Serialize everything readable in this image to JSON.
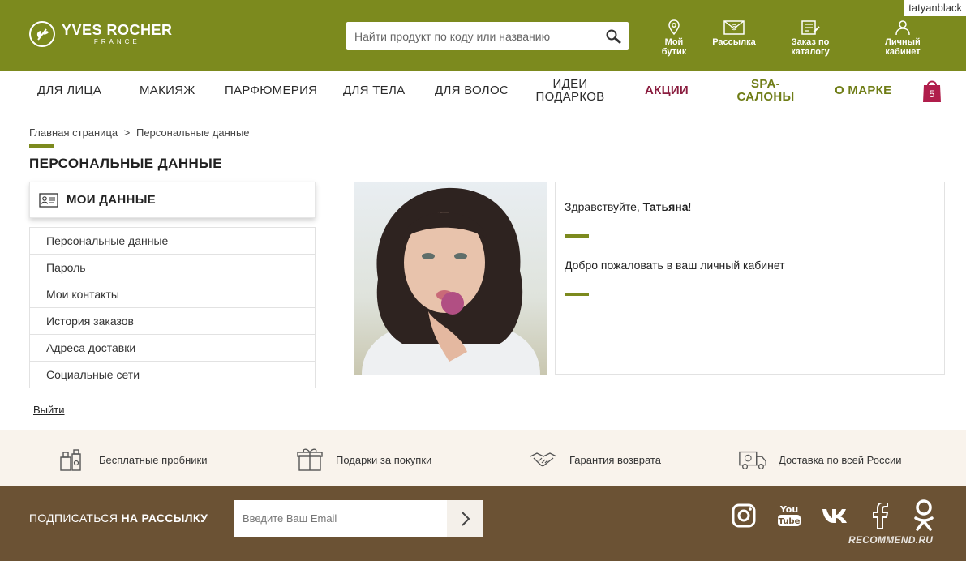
{
  "brand": {
    "name": "YVES ROCHER",
    "sub": "FRANCE",
    "color": "#7c8a1e"
  },
  "search": {
    "placeholder": "Найти продукт по коду или названию",
    "icon": "magnifier-icon"
  },
  "header_links": [
    {
      "label_line1": "Мой",
      "label_line2": "бутик",
      "icon": "location-pin-icon"
    },
    {
      "label_line1": "Рассылка",
      "label_line2": "",
      "icon": "newsletter-envelope-icon"
    },
    {
      "label_line1": "Заказ по",
      "label_line2": "каталогу",
      "icon": "catalog-order-icon"
    },
    {
      "label_line1": "Личный",
      "label_line2": "кабинет",
      "icon": "user-icon"
    }
  ],
  "username_badge": "tatyanblack",
  "nav": {
    "items": [
      {
        "label": "ДЛЯ ЛИЦА"
      },
      {
        "label": "МАКИЯЖ"
      },
      {
        "label": "ПАРФЮМЕРИЯ"
      },
      {
        "label": "ДЛЯ ТЕЛА"
      },
      {
        "label": "ДЛЯ ВОЛОС"
      },
      {
        "label_line1": "ИДЕИ",
        "label_line2": "ПОДАРКОВ"
      },
      {
        "label": "АКЦИИ"
      },
      {
        "label_line1": "SPA-",
        "label_line2": "САЛОНЫ"
      },
      {
        "label": "О МАРКЕ"
      }
    ],
    "cart_count": "5",
    "accent_color": "#8a1d3f"
  },
  "breadcrumb": {
    "home": "Главная страница",
    "separator": ">",
    "current": "Персональные данные"
  },
  "page_title": "ПЕРСОНАЛЬНЫЕ ДАННЫЕ",
  "sidebar": {
    "title": "МОИ ДАННЫЕ",
    "items": [
      {
        "label": "Персональные данные"
      },
      {
        "label": "Пароль"
      },
      {
        "label": "Мои контакты"
      },
      {
        "label": "История заказов"
      },
      {
        "label": "Адреса доставки"
      },
      {
        "label": "Социальные сети"
      }
    ],
    "logout": "Выйти"
  },
  "welcome": {
    "greeting": "Здравствуйте, ",
    "name": "Татьяна",
    "greeting_end": "!",
    "message": "Добро пожаловать в ваш личный кабинет"
  },
  "benefits": [
    {
      "label": "Бесплатные пробники",
      "icon": "samples-icon"
    },
    {
      "label": "Подарки за покупки",
      "icon": "gift-icon"
    },
    {
      "label": "Гарантия возврата",
      "icon": "handshake-icon"
    },
    {
      "label": "Доставка по всей России",
      "icon": "delivery-truck-icon"
    }
  ],
  "footer": {
    "subscribe_prefix": "ПОДПИСАТЬСЯ ",
    "subscribe_bold": "НА РАССЫЛКУ",
    "email_placeholder": "Введите Ваш Email",
    "socials": [
      "instagram-icon",
      "youtube-icon",
      "vk-icon",
      "facebook-icon",
      "odnoklassniki-icon"
    ],
    "background": "#6b5234"
  },
  "watermark": "RECOMMEND.RU"
}
